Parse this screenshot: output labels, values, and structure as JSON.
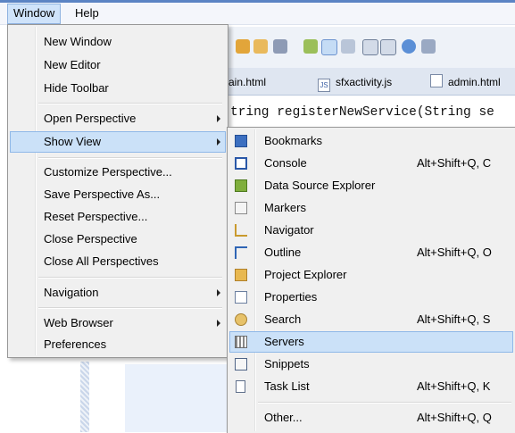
{
  "menubar": {
    "window": "Window",
    "help": "Help"
  },
  "editor": {
    "tabs": [
      "ain.html",
      "sfxactivity.js",
      "admin.html"
    ],
    "code_line": "tring registerNewService(String se"
  },
  "window_menu": {
    "items": [
      {
        "label": "New Window"
      },
      {
        "label": "New Editor"
      },
      {
        "label": "Hide Toolbar"
      },
      {
        "label": "Open Perspective",
        "submenu": true
      },
      {
        "label": "Show View",
        "submenu": true,
        "selected": true
      },
      {
        "label": "Customize Perspective..."
      },
      {
        "label": "Save Perspective As..."
      },
      {
        "label": "Reset Perspective..."
      },
      {
        "label": "Close Perspective"
      },
      {
        "label": "Close All Perspectives"
      },
      {
        "label": "Navigation",
        "submenu": true
      },
      {
        "label": "Web Browser",
        "submenu": true
      },
      {
        "label": "Preferences"
      }
    ]
  },
  "show_view_menu": {
    "items": [
      {
        "label": "Bookmarks",
        "icon": "bookmarks-icon"
      },
      {
        "label": "Console",
        "accel": "Alt+Shift+Q, C",
        "icon": "console-icon"
      },
      {
        "label": "Data Source Explorer",
        "icon": "data-source-icon"
      },
      {
        "label": "Markers",
        "icon": "markers-icon"
      },
      {
        "label": "Navigator",
        "icon": "navigator-icon"
      },
      {
        "label": "Outline",
        "accel": "Alt+Shift+Q, O",
        "icon": "outline-icon"
      },
      {
        "label": "Project Explorer",
        "icon": "project-explorer-icon"
      },
      {
        "label": "Properties",
        "icon": "properties-icon"
      },
      {
        "label": "Search",
        "accel": "Alt+Shift+Q, S",
        "icon": "search-icon"
      },
      {
        "label": "Servers",
        "selected": true,
        "icon": "servers-icon"
      },
      {
        "label": "Snippets",
        "icon": "snippets-icon"
      },
      {
        "label": "Task List",
        "accel": "Alt+Shift+Q, K",
        "icon": "task-list-icon"
      },
      {
        "label": "Other...",
        "accel": "Alt+Shift+Q, Q"
      }
    ]
  },
  "colors": {
    "selection": "#cbe1f8",
    "selection_border": "#8fb8e8",
    "menu_bg": "#f0f0f0"
  }
}
